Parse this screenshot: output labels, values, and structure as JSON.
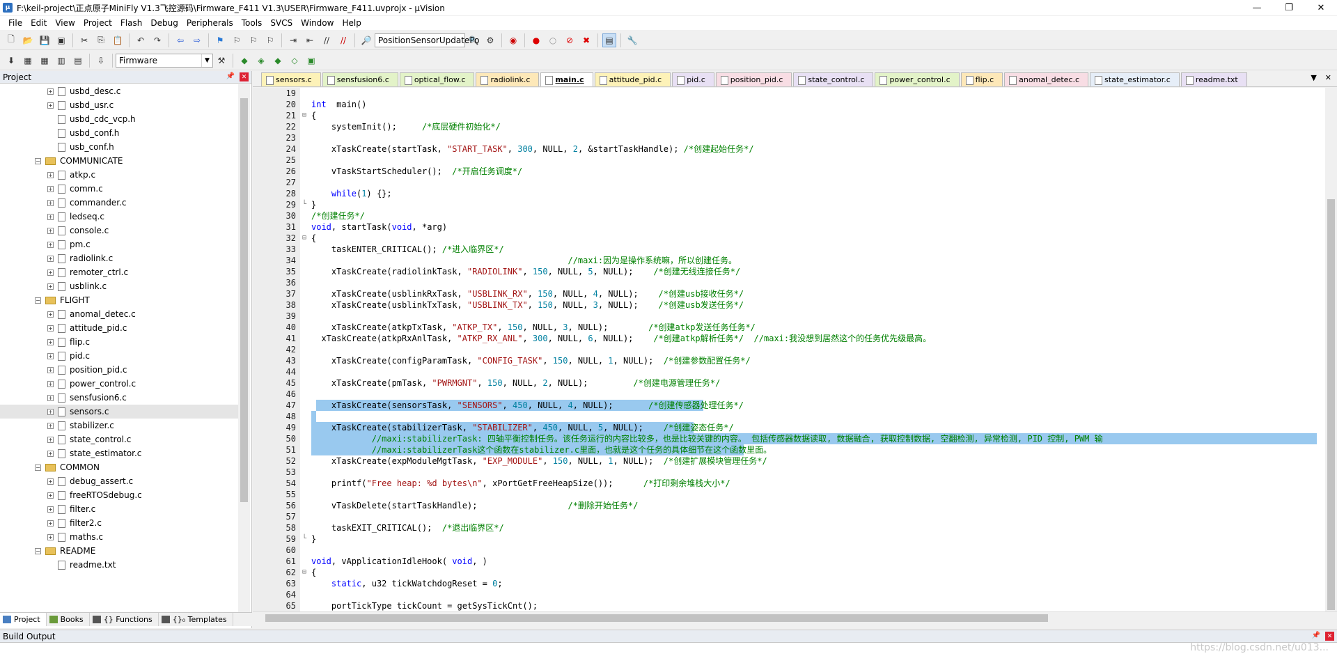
{
  "window": {
    "title": "F:\\keil-project\\正点原子MiniFly V1.3飞控源码\\Firmware_F411 V1.3\\USER\\Firmware_F411.uvprojx - µVision",
    "minimize": "—",
    "restore": "❐",
    "close": "✕"
  },
  "menu": [
    "File",
    "Edit",
    "View",
    "Project",
    "Flash",
    "Debug",
    "Peripherals",
    "Tools",
    "SVCS",
    "Window",
    "Help"
  ],
  "toolbar": {
    "find_combo_value": "PositionSensorUpdatePo",
    "target_combo_value": "Firmware"
  },
  "project_panel": {
    "title": "Project",
    "tree": [
      {
        "type": "file",
        "label": "usbd_desc.c",
        "level": 2,
        "expander": "+"
      },
      {
        "type": "file",
        "label": "usbd_usr.c",
        "level": 2,
        "expander": "+"
      },
      {
        "type": "file",
        "label": "usbd_cdc_vcp.h",
        "level": 2,
        "expander": ""
      },
      {
        "type": "file",
        "label": "usbd_conf.h",
        "level": 2,
        "expander": ""
      },
      {
        "type": "file",
        "label": "usb_conf.h",
        "level": 2,
        "expander": ""
      },
      {
        "type": "folder",
        "label": "COMMUNICATE",
        "level": 1,
        "expander": "−"
      },
      {
        "type": "file",
        "label": "atkp.c",
        "level": 2,
        "expander": "+"
      },
      {
        "type": "file",
        "label": "comm.c",
        "level": 2,
        "expander": "+"
      },
      {
        "type": "file",
        "label": "commander.c",
        "level": 2,
        "expander": "+"
      },
      {
        "type": "file",
        "label": "ledseq.c",
        "level": 2,
        "expander": "+"
      },
      {
        "type": "file",
        "label": "console.c",
        "level": 2,
        "expander": "+"
      },
      {
        "type": "file",
        "label": "pm.c",
        "level": 2,
        "expander": "+"
      },
      {
        "type": "file",
        "label": "radiolink.c",
        "level": 2,
        "expander": "+"
      },
      {
        "type": "file",
        "label": "remoter_ctrl.c",
        "level": 2,
        "expander": "+"
      },
      {
        "type": "file",
        "label": "usblink.c",
        "level": 2,
        "expander": "+"
      },
      {
        "type": "folder",
        "label": "FLIGHT",
        "level": 1,
        "expander": "−"
      },
      {
        "type": "file",
        "label": "anomal_detec.c",
        "level": 2,
        "expander": "+"
      },
      {
        "type": "file",
        "label": "attitude_pid.c",
        "level": 2,
        "expander": "+"
      },
      {
        "type": "file",
        "label": "flip.c",
        "level": 2,
        "expander": "+"
      },
      {
        "type": "file",
        "label": "pid.c",
        "level": 2,
        "expander": "+"
      },
      {
        "type": "file",
        "label": "position_pid.c",
        "level": 2,
        "expander": "+"
      },
      {
        "type": "file",
        "label": "power_control.c",
        "level": 2,
        "expander": "+"
      },
      {
        "type": "file",
        "label": "sensfusion6.c",
        "level": 2,
        "expander": "+"
      },
      {
        "type": "file",
        "label": "sensors.c",
        "level": 2,
        "expander": "+",
        "selected": true
      },
      {
        "type": "file",
        "label": "stabilizer.c",
        "level": 2,
        "expander": "+"
      },
      {
        "type": "file",
        "label": "state_control.c",
        "level": 2,
        "expander": "+"
      },
      {
        "type": "file",
        "label": "state_estimator.c",
        "level": 2,
        "expander": "+"
      },
      {
        "type": "folder",
        "label": "COMMON",
        "level": 1,
        "expander": "−"
      },
      {
        "type": "file",
        "label": "debug_assert.c",
        "level": 2,
        "expander": "+"
      },
      {
        "type": "file",
        "label": "freeRTOSdebug.c",
        "level": 2,
        "expander": "+"
      },
      {
        "type": "file",
        "label": "filter.c",
        "level": 2,
        "expander": "+"
      },
      {
        "type": "file",
        "label": "filter2.c",
        "level": 2,
        "expander": "+"
      },
      {
        "type": "file",
        "label": "maths.c",
        "level": 2,
        "expander": "+"
      },
      {
        "type": "folder",
        "label": "README",
        "level": 1,
        "expander": "−"
      },
      {
        "type": "file",
        "label": "readme.txt",
        "level": 2,
        "expander": ""
      }
    ],
    "tabs": [
      "Project",
      "Books",
      "{} Functions",
      "{}₀ Templates"
    ]
  },
  "editor": {
    "tabs": [
      {
        "label": "sensors.c",
        "color": "#fdf2b8"
      },
      {
        "label": "sensfusion6.c",
        "color": "#e3f3c8"
      },
      {
        "label": "optical_flow.c",
        "color": "#e3f3c8"
      },
      {
        "label": "radiolink.c",
        "color": "#fde8b8"
      },
      {
        "label": "main.c",
        "color": "#ffffff",
        "active": true
      },
      {
        "label": "attitude_pid.c",
        "color": "#fdf2b8"
      },
      {
        "label": "pid.c",
        "color": "#e8e0f4"
      },
      {
        "label": "position_pid.c",
        "color": "#f8dde4"
      },
      {
        "label": "state_control.c",
        "color": "#e8e0f4"
      },
      {
        "label": "power_control.c",
        "color": "#e3f3c8"
      },
      {
        "label": "flip.c",
        "color": "#fde8b8"
      },
      {
        "label": "anomal_detec.c",
        "color": "#f8dde4"
      },
      {
        "label": "state_estimator.c",
        "color": "#e6eef8"
      },
      {
        "label": "readme.txt",
        "color": "#e8e0f4"
      }
    ],
    "lines": [
      {
        "n": "19",
        "fold": "",
        "parts": []
      },
      {
        "n": "20",
        "fold": "",
        "parts": [
          [
            "kw",
            "int"
          ],
          [
            "",
            "  main()"
          ]
        ]
      },
      {
        "n": "21",
        "fold": "⊟",
        "parts": [
          [
            "",
            "{"
          ]
        ]
      },
      {
        "n": "22",
        "fold": "",
        "parts": [
          [
            "",
            "    systemInit();     "
          ],
          [
            "cmt",
            "/*底层硬件初始化*/"
          ]
        ]
      },
      {
        "n": "23",
        "fold": "",
        "parts": []
      },
      {
        "n": "24",
        "fold": "",
        "parts": [
          [
            "",
            "    xTaskCreate(startTask, "
          ],
          [
            "str",
            "\"START_TASK\""
          ],
          [
            "",
            ", "
          ],
          [
            "num",
            "300"
          ],
          [
            "",
            ", NULL, "
          ],
          [
            "num",
            "2"
          ],
          [
            "",
            ", &startTaskHandle); "
          ],
          [
            "cmt",
            "/*创建起始任务*/"
          ]
        ]
      },
      {
        "n": "25",
        "fold": "",
        "parts": []
      },
      {
        "n": "26",
        "fold": "",
        "parts": [
          [
            "",
            "    vTaskStartScheduler();  "
          ],
          [
            "cmt",
            "/*开启任务调度*/"
          ]
        ]
      },
      {
        "n": "27",
        "fold": "",
        "parts": []
      },
      {
        "n": "28",
        "fold": "",
        "parts": [
          [
            "",
            "    "
          ],
          [
            "kw",
            "while"
          ],
          [
            "",
            "("
          ],
          [
            "num",
            "1"
          ],
          [
            "",
            ") {};"
          ]
        ]
      },
      {
        "n": "29",
        "fold": "└",
        "parts": [
          [
            "",
            "}"
          ]
        ]
      },
      {
        "n": "30",
        "fold": "",
        "parts": [
          [
            "cmt",
            "/*创建任务*/"
          ]
        ]
      },
      {
        "n": "31",
        "fold": "",
        "parts": [
          [
            "kw",
            "void"
          ],
          [
            "",
            ", startTask("
          ],
          [
            "kw",
            "void"
          ],
          [
            "",
            ", *arg)"
          ]
        ]
      },
      {
        "n": "32",
        "fold": "⊟",
        "parts": [
          [
            "",
            "{"
          ]
        ]
      },
      {
        "n": "33",
        "fold": "",
        "parts": [
          [
            "",
            "    taskENTER_CRITICAL(); "
          ],
          [
            "cmt",
            "/*进入临界区*/"
          ]
        ]
      },
      {
        "n": "34",
        "fold": "",
        "parts": [
          [
            "",
            "                                                   "
          ],
          [
            "cmt",
            "//maxi:因为是操作系统嘛，所以创建任务。"
          ]
        ]
      },
      {
        "n": "35",
        "fold": "",
        "parts": [
          [
            "",
            "    xTaskCreate(radiolinkTask, "
          ],
          [
            "str",
            "\"RADIOLINK\""
          ],
          [
            "",
            ", "
          ],
          [
            "num",
            "150"
          ],
          [
            "",
            ", NULL, "
          ],
          [
            "num",
            "5"
          ],
          [
            "",
            ", NULL);    "
          ],
          [
            "cmt",
            "/*创建无线连接任务*/"
          ]
        ]
      },
      {
        "n": "36",
        "fold": "",
        "parts": []
      },
      {
        "n": "37",
        "fold": "",
        "parts": [
          [
            "",
            "    xTaskCreate(usblinkRxTask, "
          ],
          [
            "str",
            "\"USBLINK_RX\""
          ],
          [
            "",
            ", "
          ],
          [
            "num",
            "150"
          ],
          [
            "",
            ", NULL, "
          ],
          [
            "num",
            "4"
          ],
          [
            "",
            ", NULL);    "
          ],
          [
            "cmt",
            "/*创建usb接收任务*/"
          ]
        ]
      },
      {
        "n": "38",
        "fold": "",
        "parts": [
          [
            "",
            "    xTaskCreate(usblinkTxTask, "
          ],
          [
            "str",
            "\"USBLINK_TX\""
          ],
          [
            "",
            ", "
          ],
          [
            "num",
            "150"
          ],
          [
            "",
            ", NULL, "
          ],
          [
            "num",
            "3"
          ],
          [
            "",
            ", NULL);    "
          ],
          [
            "cmt",
            "/*创建usb发送任务*/"
          ]
        ]
      },
      {
        "n": "39",
        "fold": "",
        "parts": []
      },
      {
        "n": "40",
        "fold": "",
        "parts": [
          [
            "",
            "    xTaskCreate(atkpTxTask, "
          ],
          [
            "str",
            "\"ATKP_TX\""
          ],
          [
            "",
            ", "
          ],
          [
            "num",
            "150"
          ],
          [
            "",
            ", NULL, "
          ],
          [
            "num",
            "3"
          ],
          [
            "",
            ", NULL);        "
          ],
          [
            "cmt",
            "/*创建atkp发送任务任务*/"
          ]
        ]
      },
      {
        "n": "41",
        "fold": "",
        "parts": [
          [
            "",
            "  xTaskCreate(atkpRxAnlTask, "
          ],
          [
            "str",
            "\"ATKP_RX_ANL\""
          ],
          [
            "",
            ", "
          ],
          [
            "num",
            "300"
          ],
          [
            "",
            ", NULL, "
          ],
          [
            "num",
            "6"
          ],
          [
            "",
            ", NULL);    "
          ],
          [
            "cmt",
            "/*创建atkp解析任务*/  //maxi:我没想到居然这个的任务优先级最高。"
          ]
        ]
      },
      {
        "n": "42",
        "fold": "",
        "parts": []
      },
      {
        "n": "43",
        "fold": "",
        "parts": [
          [
            "",
            "    xTaskCreate(configParamTask, "
          ],
          [
            "str",
            "\"CONFIG_TASK\""
          ],
          [
            "",
            ", "
          ],
          [
            "num",
            "150"
          ],
          [
            "",
            ", NULL, "
          ],
          [
            "num",
            "1"
          ],
          [
            "",
            ", NULL);  "
          ],
          [
            "cmt",
            "/*创建参数配置任务*/"
          ]
        ]
      },
      {
        "n": "44",
        "fold": "",
        "parts": []
      },
      {
        "n": "45",
        "fold": "",
        "parts": [
          [
            "",
            "    xTaskCreate(pmTask, "
          ],
          [
            "str",
            "\"PWRMGNT\""
          ],
          [
            "",
            ", "
          ],
          [
            "num",
            "150"
          ],
          [
            "",
            ", NULL, "
          ],
          [
            "num",
            "2"
          ],
          [
            "",
            ", NULL);         "
          ],
          [
            "cmt",
            "/*创建电源管理任务*/"
          ]
        ]
      },
      {
        "n": "46",
        "fold": "",
        "parts": []
      },
      {
        "n": "47",
        "fold": "",
        "sel": [
          1,
          78
        ],
        "parts": [
          [
            "",
            "    xTaskCreate(sensorsTask, "
          ],
          [
            "str",
            "\"SENSORS\""
          ],
          [
            "",
            ", "
          ],
          [
            "num",
            "450"
          ],
          [
            "",
            ", NULL, "
          ],
          [
            "num",
            "4"
          ],
          [
            "",
            ", NULL);       "
          ],
          [
            "cmt",
            "/*创建传感器处理任务*/"
          ]
        ]
      },
      {
        "n": "48",
        "fold": "",
        "sel": [
          0,
          1
        ],
        "parts": []
      },
      {
        "n": "49",
        "fold": "",
        "sel": [
          0,
          76
        ],
        "parts": [
          [
            "",
            "    xTaskCreate(stabilizerTask, "
          ],
          [
            "str",
            "\"STABILIZER\""
          ],
          [
            "",
            ", "
          ],
          [
            "num",
            "450"
          ],
          [
            "",
            ", NULL, "
          ],
          [
            "num",
            "5"
          ],
          [
            "",
            ", NULL);    "
          ],
          [
            "cmt",
            "/*创建姿态任务*/"
          ]
        ]
      },
      {
        "n": "50",
        "fold": "",
        "sel": [
          0,
          200
        ],
        "parts": [
          [
            "",
            "            "
          ],
          [
            "cmt",
            "//maxi:stabilizerTask: 四轴平衡控制任务。该任务运行的内容比较多，也是比较关键的内容。 包括传感器数据读取, 数据融合, 获取控制数据, 空翻检测, 异常检测, PID 控制, PWM 输"
          ]
        ]
      },
      {
        "n": "51",
        "fold": "",
        "sel": [
          0,
          86
        ],
        "parts": [
          [
            "",
            "            "
          ],
          [
            "cmt",
            "//maxi:stabilizerTask这个函数在stabilizer.c里面，也就是这个任务的具体细节在这个函数里面。"
          ]
        ]
      },
      {
        "n": "52",
        "fold": "",
        "parts": [
          [
            "",
            "    xTaskCreate(expModuleMgtTask, "
          ],
          [
            "str",
            "\"EXP_MODULE\""
          ],
          [
            "",
            ", "
          ],
          [
            "num",
            "150"
          ],
          [
            "",
            ", NULL, "
          ],
          [
            "num",
            "1"
          ],
          [
            "",
            ", NULL);  "
          ],
          [
            "cmt",
            "/*创建扩展模块管理任务*/"
          ]
        ]
      },
      {
        "n": "53",
        "fold": "",
        "parts": []
      },
      {
        "n": "54",
        "fold": "",
        "parts": [
          [
            "",
            "    printf("
          ],
          [
            "str",
            "\"Free heap: %d bytes\\n\""
          ],
          [
            "",
            ", xPortGetFreeHeapSize());      "
          ],
          [
            "cmt",
            "/*打印剩余堆栈大小*/"
          ]
        ]
      },
      {
        "n": "55",
        "fold": "",
        "parts": []
      },
      {
        "n": "56",
        "fold": "",
        "parts": [
          [
            "",
            "    vTaskDelete(startTaskHandle);                  "
          ],
          [
            "cmt",
            "/*删除开始任务*/"
          ]
        ]
      },
      {
        "n": "57",
        "fold": "",
        "parts": []
      },
      {
        "n": "58",
        "fold": "",
        "parts": [
          [
            "",
            "    taskEXIT_CRITICAL();  "
          ],
          [
            "cmt",
            "/*退出临界区*/"
          ]
        ]
      },
      {
        "n": "59",
        "fold": "└",
        "parts": [
          [
            "",
            "}"
          ]
        ]
      },
      {
        "n": "60",
        "fold": "",
        "parts": []
      },
      {
        "n": "61",
        "fold": "",
        "parts": [
          [
            "kw",
            "void"
          ],
          [
            "",
            ", vApplicationIdleHook( "
          ],
          [
            "kw",
            "void"
          ],
          [
            "",
            ", )"
          ]
        ]
      },
      {
        "n": "62",
        "fold": "⊟",
        "parts": [
          [
            "",
            "{"
          ]
        ]
      },
      {
        "n": "63",
        "fold": "",
        "parts": [
          [
            "",
            "    "
          ],
          [
            "kw",
            "static"
          ],
          [
            "",
            ", u32 tickWatchdogReset = "
          ],
          [
            "num",
            "0"
          ],
          [
            "",
            ";"
          ]
        ]
      },
      {
        "n": "64",
        "fold": "",
        "parts": []
      },
      {
        "n": "65",
        "fold": "",
        "parts": [
          [
            "",
            "    portTickType tickCount = getSysTickCnt();"
          ]
        ]
      }
    ]
  },
  "build_output": {
    "title": "Build Output"
  },
  "watermark": "https://blog.csdn.net/u013..."
}
